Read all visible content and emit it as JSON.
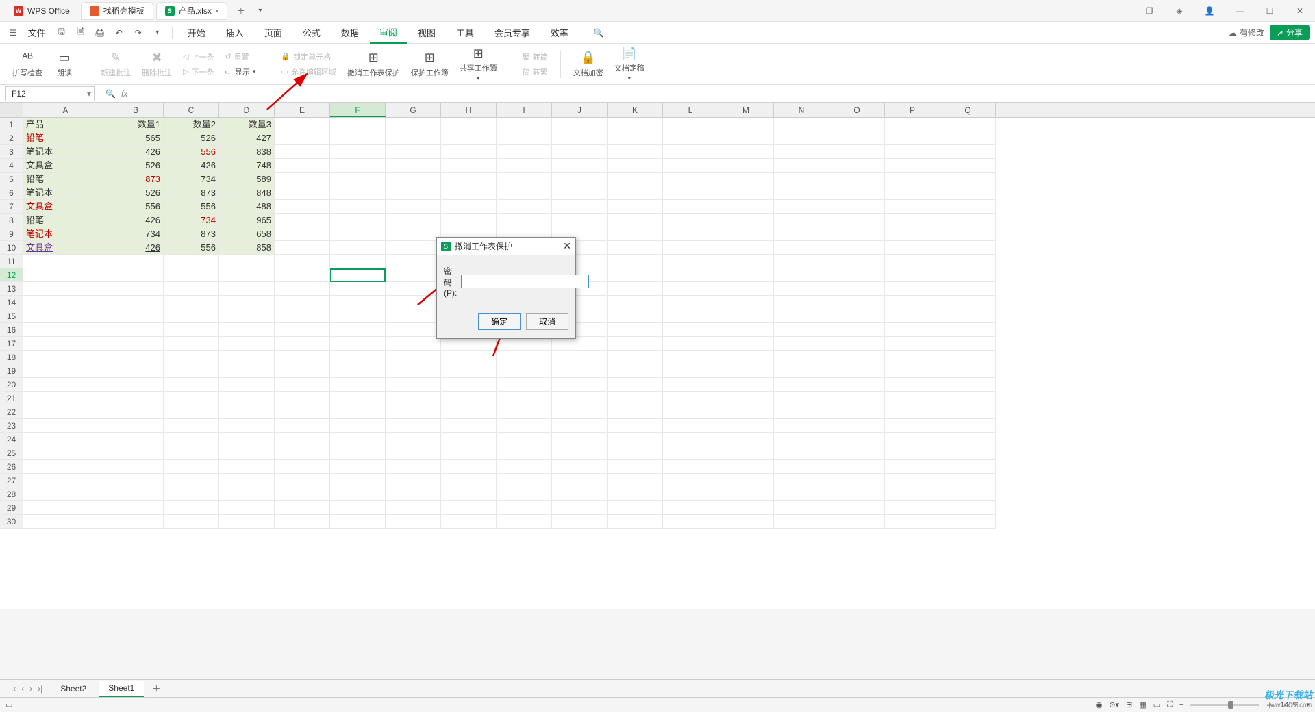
{
  "tabs": {
    "wps": "WPS Office",
    "template": "找稻壳模板",
    "file": "产品.xlsx"
  },
  "menu": {
    "file": "文件",
    "items": [
      "开始",
      "插入",
      "页面",
      "公式",
      "数据",
      "审阅",
      "视图",
      "工具",
      "会员专享",
      "效率"
    ]
  },
  "titlebar_right": {
    "has_changes": "有修改",
    "share": "分享"
  },
  "ribbon": {
    "spellcheck": "拼写检查",
    "readaloud": "朗读",
    "newcomment": "新建批注",
    "deletecomment": "删除批注",
    "prev": "上一条",
    "next": "下一条",
    "reset": "重置",
    "show": "显示",
    "lockcell": "锁定单元格",
    "alloweditarea": "允许编辑区域",
    "unprotect": "撤消工作表保护",
    "protectwb": "保护工作簿",
    "sharewb": "共享工作簿",
    "simplified": "转简",
    "traditional": "转繁",
    "encrypt": "文档加密",
    "finalize": "文档定稿"
  },
  "namebox": "F12",
  "columns": [
    "A",
    "B",
    "C",
    "D",
    "E",
    "F",
    "G",
    "H",
    "I",
    "J",
    "K",
    "L",
    "M",
    "N",
    "O",
    "P",
    "Q"
  ],
  "headers": [
    "产品",
    "数量1",
    "数量2",
    "数量3"
  ],
  "rows": [
    {
      "p": "铅笔",
      "c": "red",
      "v": [
        565,
        526,
        427
      ],
      "f": [
        null,
        null,
        null
      ]
    },
    {
      "p": "笔记本",
      "c": null,
      "v": [
        426,
        556,
        838
      ],
      "f": [
        null,
        "red",
        null
      ]
    },
    {
      "p": "文具盒",
      "c": null,
      "v": [
        526,
        426,
        748
      ],
      "f": [
        null,
        null,
        null
      ]
    },
    {
      "p": "铅笔",
      "c": null,
      "v": [
        873,
        734,
        589
      ],
      "f": [
        "red",
        null,
        null
      ]
    },
    {
      "p": "笔记本",
      "c": null,
      "v": [
        526,
        873,
        848
      ],
      "f": [
        null,
        null,
        null
      ]
    },
    {
      "p": "文具盒",
      "c": "red",
      "v": [
        556,
        556,
        488
      ],
      "f": [
        null,
        null,
        null
      ]
    },
    {
      "p": "铅笔",
      "c": null,
      "v": [
        426,
        734,
        965
      ],
      "f": [
        null,
        "red",
        null
      ]
    },
    {
      "p": "笔记本",
      "c": "red",
      "v": [
        734,
        873,
        658
      ],
      "f": [
        null,
        null,
        null
      ]
    },
    {
      "p": "文具盒",
      "c": "purple",
      "v": [
        426,
        556,
        858
      ],
      "f": [
        "underline",
        null,
        null
      ]
    }
  ],
  "dialog": {
    "title": "撤消工作表保护",
    "password_label": "密码(P):",
    "ok": "确定",
    "cancel": "取消"
  },
  "sheets": {
    "nav": [
      "Sheet2",
      "Sheet1"
    ]
  },
  "status": {
    "zoom": "145%"
  },
  "watermark": {
    "name": "极光下载站",
    "url": "www.xz7.com"
  }
}
